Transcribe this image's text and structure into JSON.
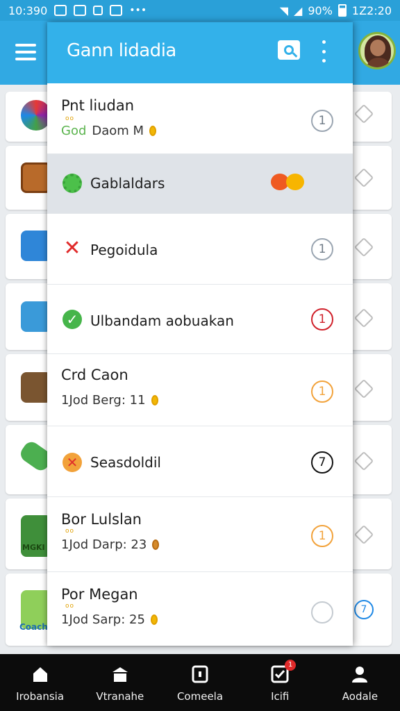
{
  "status_bar": {
    "time_left": "10:390",
    "battery_percent": "90%",
    "time_right": "1Z2:20",
    "icons": [
      "mail-icon",
      "check-mail-icon",
      "notification-icon",
      "message-icon",
      "more-notifications-icon",
      "wifi-icon",
      "signal-icon",
      "battery-icon"
    ]
  },
  "app_bar": {
    "menu_icon": "hamburger-icon",
    "avatar": "profile-avatar"
  },
  "drawer": {
    "title": "Gann lidadia",
    "search_icon": "search-icon",
    "more_icon": "more-vertical-icon",
    "items": [
      {
        "type": "detail",
        "title": "Pnt liudan",
        "dots": "oo",
        "sub_prefix": "God",
        "sub_text": "Daom M",
        "coin": "gold",
        "badge": "1",
        "badge_style": "gray"
      },
      {
        "type": "simple",
        "icon": "gear-icon",
        "label": "Gablaldars",
        "selected": true,
        "decoration": "fruit-icons",
        "badge": "",
        "badge_style": "none"
      },
      {
        "type": "simple",
        "icon": "close-x-icon",
        "label": "Pegoidula",
        "badge": "1",
        "badge_style": "gray"
      },
      {
        "type": "simple",
        "icon": "check-circle-icon",
        "label": "Ulbandam aobuakan",
        "badge": "1",
        "badge_style": "red"
      },
      {
        "type": "detail",
        "title": "Crd Caon",
        "dots": "",
        "sub_prefix": "",
        "sub_text": "1Jod Berg: 11",
        "coin": "gold",
        "badge": "1",
        "badge_style": "orange"
      },
      {
        "type": "simple",
        "icon": "pill-icon",
        "label": "Seasdoldil",
        "badge": "7",
        "badge_style": "black"
      },
      {
        "type": "detail",
        "title": "Bor Lulslan",
        "dots": "oo",
        "sub_prefix": "",
        "sub_text": "1Jod Darp: 23",
        "coin": "bronze",
        "badge": "1",
        "badge_style": "orange"
      },
      {
        "type": "detail",
        "title": "Por Megan",
        "dots": "oo",
        "sub_prefix": "",
        "sub_text": "1Jod Sarp: 25",
        "coin": "gold",
        "badge": "",
        "badge_style": "faint"
      }
    ]
  },
  "background_list": {
    "thumb_label": "MGKI",
    "thumb_label_2": "Coach",
    "side_badge": "7"
  },
  "bottom_nav": [
    {
      "label": "Irobansia",
      "icon": "home-icon"
    },
    {
      "label": "Vtranahe",
      "icon": "store-icon"
    },
    {
      "label": "Comeela",
      "icon": "card-icon"
    },
    {
      "label": "Icifi",
      "icon": "tasks-icon",
      "badge": "1"
    },
    {
      "label": "Aodale",
      "icon": "profile-icon"
    }
  ],
  "colors": {
    "primary": "#31a9e3",
    "drawer_header": "#33b1ea",
    "selected_row": "#dfe3e8",
    "nav_bg": "#0c0c0c"
  }
}
